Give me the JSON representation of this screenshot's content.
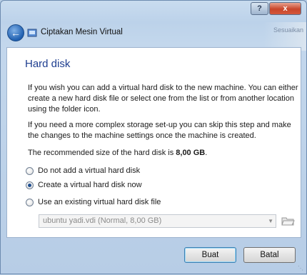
{
  "window": {
    "title": "Ciptakan Mesin Virtual",
    "help_label": "?",
    "close_label": "x",
    "background_text": "Sesuaikan"
  },
  "page": {
    "heading": "Hard disk",
    "paragraph1": "If you wish you can add a virtual hard disk to the new machine. You can either create a new hard disk file or select one from the list or from another location using the folder icon.",
    "paragraph2": "If you need a more complex storage set-up you can skip this step and make the changes to the machine settings once the machine is created.",
    "recommended_prefix": "The recommended size of the hard disk is ",
    "recommended_size": "8,00 GB",
    "recommended_suffix": "."
  },
  "options": [
    {
      "label": "Do not add a virtual hard disk",
      "selected": false
    },
    {
      "label": "Create a virtual hard disk now",
      "selected": true
    },
    {
      "label": "Use an existing virtual hard disk file",
      "selected": false
    }
  ],
  "existing_disk": {
    "value": "ubuntu yadi.vdi (Normal, 8,00 GB)",
    "enabled": false
  },
  "buttons": {
    "create": "Buat",
    "cancel": "Batal"
  },
  "colors": {
    "heading": "#1d3d8f",
    "frame": "#bcd2ea",
    "close": "#c9452a"
  },
  "icons": [
    "back-arrow-icon",
    "virtualbox-icon",
    "folder-icon",
    "chevron-down-icon"
  ]
}
